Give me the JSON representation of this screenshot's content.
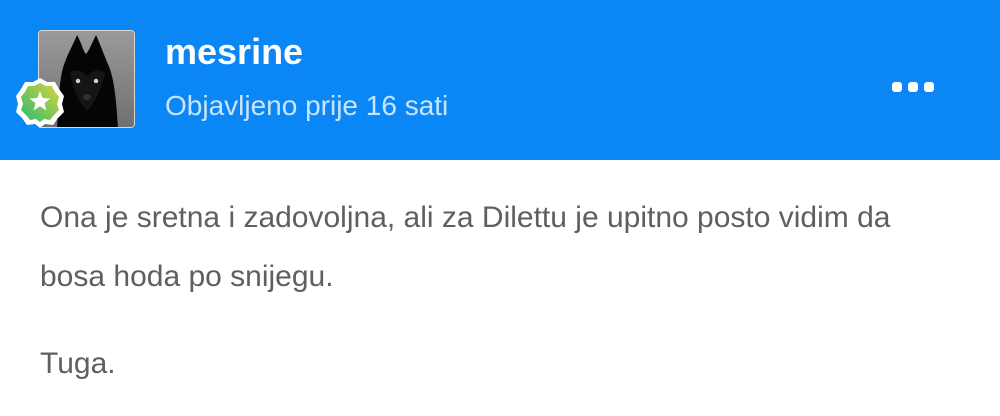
{
  "author": {
    "name": "mesrine",
    "avatar_icon": "black-wolf-photo",
    "badge_icon": "star-rank-badge-icon"
  },
  "post": {
    "meta": "Objavljeno prije 16 sati",
    "paragraphs": [
      "Ona je sretna i zadovoljna, ali za Dilettu je upitno posto vidim da bosa hoda po snijegu.",
      "Tuga."
    ]
  },
  "menu": {
    "icon": "more-options-icon"
  },
  "colors": {
    "header_background": "#0a86f5",
    "body_text": "#5f5f5f",
    "meta_text": "#d2e8ff",
    "badge_gradient_start": "#2eb872",
    "badge_gradient_end": "#d7d63c"
  }
}
